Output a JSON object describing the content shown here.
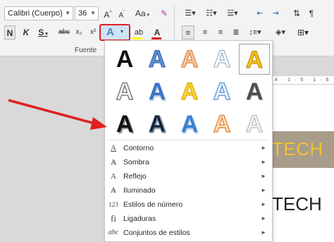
{
  "ribbon": {
    "font_name": "Calibri (Cuerpo)",
    "font_size": "36",
    "group_label": "Fuente",
    "grow_font": "A",
    "shrink_font": "A",
    "change_case": "Aa",
    "bold": "N",
    "italic": "K",
    "underline": "S",
    "strike": "abc",
    "subscript": "x₂",
    "superscript": "x²",
    "text_effects": "A",
    "highlight": "ab",
    "font_color": "A"
  },
  "text_effects_menu": {
    "gallery_rows": [
      [
        "A",
        "A",
        "A",
        "A",
        "A"
      ],
      [
        "A",
        "A",
        "A",
        "A",
        "A"
      ],
      [
        "A",
        "A",
        "A",
        "A",
        "A"
      ]
    ],
    "items": [
      {
        "label": "Contorno",
        "icon": "A"
      },
      {
        "label": "Sombra",
        "icon": "A"
      },
      {
        "label": "Reflejo",
        "icon": "A"
      },
      {
        "label": "Iluminado",
        "icon": "A"
      },
      {
        "label": "Estilos de número",
        "icon": "123"
      },
      {
        "label": "Ligaduras",
        "icon": "fi"
      },
      {
        "label": "Conjuntos de estilos",
        "icon": "abc"
      }
    ]
  },
  "document": {
    "ruler": "4 · 1 · 5 · 1 · 6",
    "banner_text": "TECH",
    "plain_text": "TECH"
  },
  "colors": {
    "accent_red": "#e02020",
    "selection_blue": "#cfe3f7",
    "highlight_yellow": "#ffff00"
  }
}
